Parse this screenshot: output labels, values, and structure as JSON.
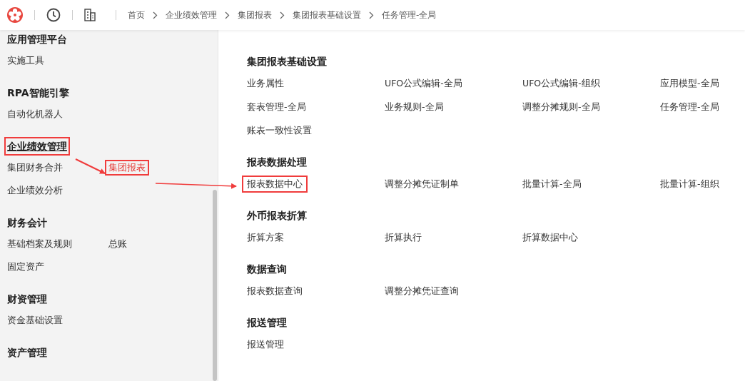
{
  "breadcrumbs": [
    "首页",
    "企业绩效管理",
    "集团报表",
    "集团报表基础设置",
    "任务管理-全局"
  ],
  "sidebar": {
    "sections": [
      {
        "title": "应用管理平台",
        "highlighted": false,
        "items": [
          {
            "label": "实施工具",
            "selected": false,
            "highlighted": false
          }
        ]
      },
      {
        "title": "RPA智能引擎",
        "highlighted": false,
        "items": [
          {
            "label": "自动化机器人",
            "selected": false,
            "highlighted": false
          }
        ]
      },
      {
        "title": "企业绩效管理",
        "highlighted": true,
        "items": [
          {
            "label": "集团财务合并",
            "selected": false,
            "highlighted": false
          },
          {
            "label": "集团报表",
            "selected": true,
            "highlighted": true
          },
          {
            "label": "企业绩效分析",
            "selected": false,
            "highlighted": false
          }
        ]
      },
      {
        "title": "财务会计",
        "highlighted": false,
        "items": [
          {
            "label": "基础档案及规则",
            "selected": false,
            "highlighted": false
          },
          {
            "label": "总账",
            "selected": false,
            "highlighted": false
          },
          {
            "label": "固定资产",
            "selected": false,
            "highlighted": false
          }
        ]
      },
      {
        "title": "财资管理",
        "highlighted": false,
        "items": [
          {
            "label": "资金基础设置",
            "selected": false,
            "highlighted": false
          }
        ]
      },
      {
        "title": "资产管理",
        "highlighted": false
      }
    ]
  },
  "groups": [
    {
      "title": "集团报表基础设置",
      "items": [
        {
          "label": "业务属性",
          "highlighted": false
        },
        {
          "label": "UFO公式编辑-全局",
          "highlighted": false
        },
        {
          "label": "UFO公式编辑-组织",
          "highlighted": false
        },
        {
          "label": "应用模型-全局",
          "highlighted": false
        },
        {
          "label": "套表管理-全局",
          "highlighted": false
        },
        {
          "label": "业务规则-全局",
          "highlighted": false
        },
        {
          "label": "调整分摊规则-全局",
          "highlighted": false
        },
        {
          "label": "任务管理-全局",
          "highlighted": false
        },
        {
          "label": "账表一致性设置",
          "highlighted": false
        }
      ]
    },
    {
      "title": "报表数据处理",
      "items": [
        {
          "label": "报表数据中心",
          "highlighted": true
        },
        {
          "label": "调整分摊凭证制单",
          "highlighted": false
        },
        {
          "label": "批量计算-全局",
          "highlighted": false
        },
        {
          "label": "批量计算-组织",
          "highlighted": false
        }
      ]
    },
    {
      "title": "外币报表折算",
      "items": [
        {
          "label": "折算方案",
          "highlighted": false
        },
        {
          "label": "折算执行",
          "highlighted": false
        },
        {
          "label": "折算数据中心",
          "highlighted": false
        }
      ]
    },
    {
      "title": "数据查询",
      "items": [
        {
          "label": "报表数据查询",
          "highlighted": false
        },
        {
          "label": "调整分摊凭证查询",
          "highlighted": false
        }
      ]
    },
    {
      "title": "报送管理",
      "items": [
        {
          "label": "报送管理",
          "highlighted": false
        }
      ]
    }
  ]
}
